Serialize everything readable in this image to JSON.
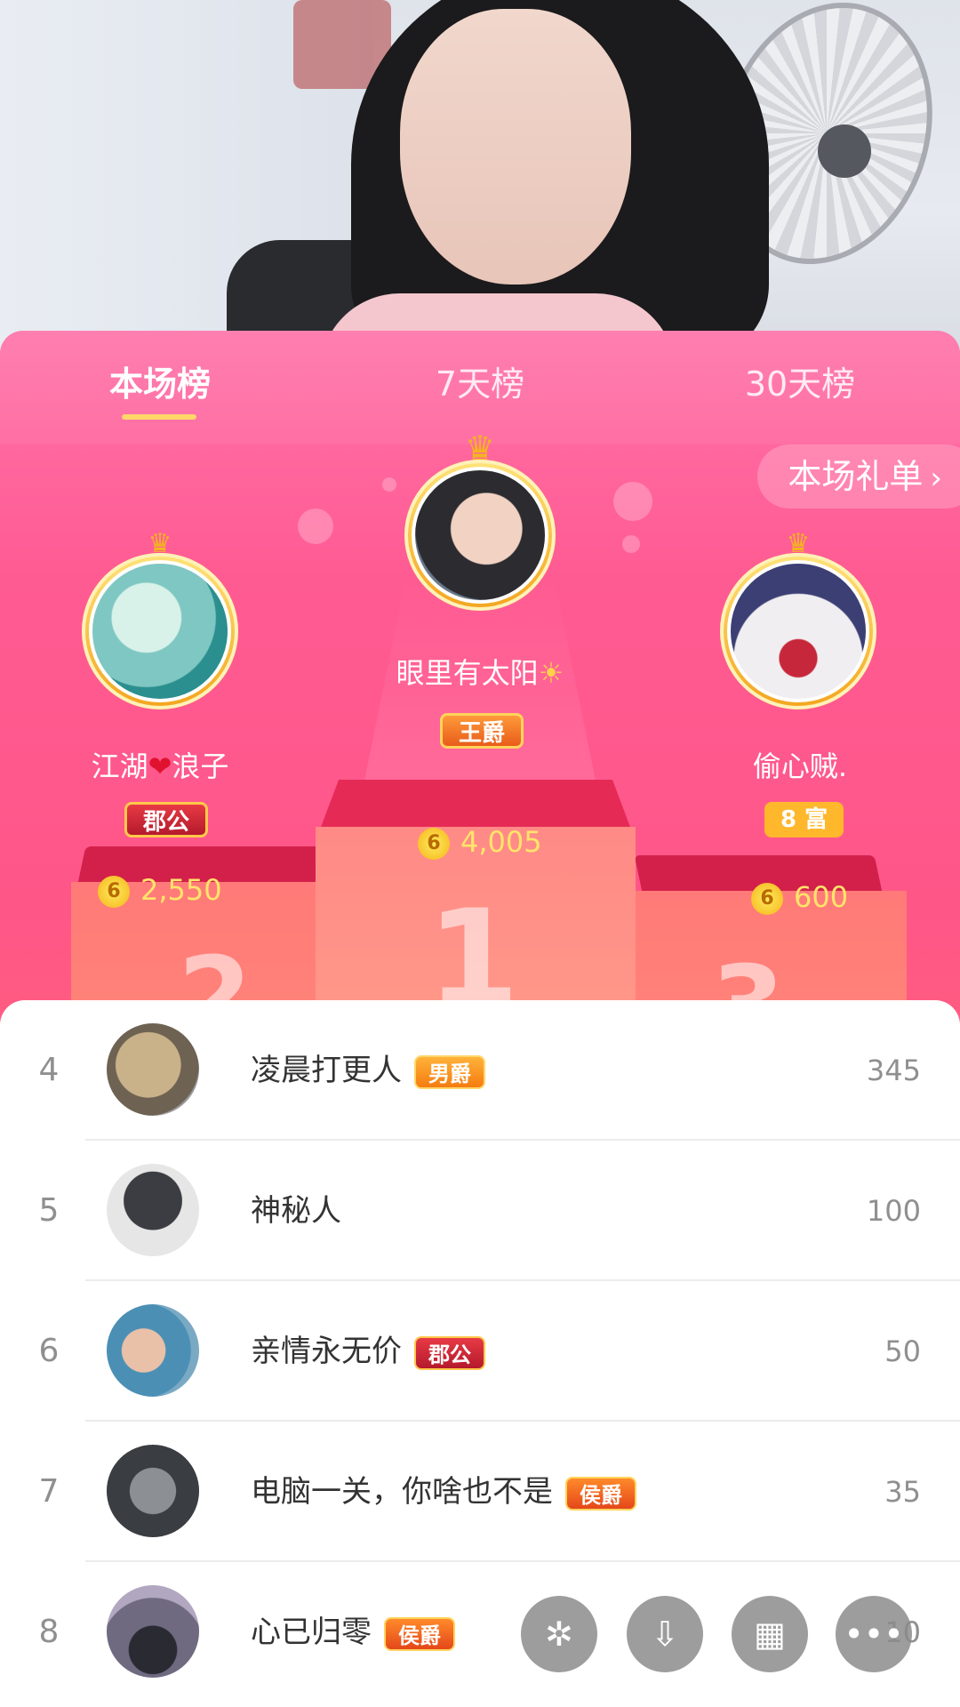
{
  "tabs": [
    {
      "label": "本场榜",
      "active": true
    },
    {
      "label": "7天榜",
      "active": false
    },
    {
      "label": "30天榜",
      "active": false
    }
  ],
  "gift_list_label": "本场礼单",
  "top3": [
    {
      "rank": 1,
      "name": "眼里有太阳",
      "name_emoji": "☀",
      "badge": "王爵",
      "score": "4,005",
      "podium_number": "1"
    },
    {
      "rank": 2,
      "name_left": "江湖",
      "name_heart": "❤",
      "name_right": "浪子",
      "badge": "郡公",
      "score": "2,550",
      "podium_number": "2"
    },
    {
      "rank": 3,
      "name": "偷心贼.",
      "badge": "8 富",
      "score": "600",
      "podium_number": "3"
    }
  ],
  "coin_glyph": "6",
  "list": [
    {
      "rank": "4",
      "name": "凌晨打更人",
      "tag": "男爵",
      "value": "345"
    },
    {
      "rank": "5",
      "name": "神秘人",
      "tag": "",
      "value": "100"
    },
    {
      "rank": "6",
      "name": "亲情永无价",
      "tag": "郡公",
      "value": "50"
    },
    {
      "rank": "7",
      "name": "电脑一关，你啥也不是",
      "tag": "侯爵",
      "value": "35"
    },
    {
      "rank": "8",
      "name": "心已归零",
      "tag": "侯爵",
      "value": "10"
    }
  ],
  "fabs": [
    {
      "icon": "share-icon",
      "glyph": "✲"
    },
    {
      "icon": "download-icon",
      "glyph": "⇩"
    },
    {
      "icon": "grid-icon",
      "glyph": "▦"
    },
    {
      "icon": "more-icon",
      "glyph": "•••"
    }
  ],
  "colors": {
    "panel_pink": "#ff5b93",
    "tab_underline": "#ffd76a",
    "score_gold": "#ffe46a"
  }
}
